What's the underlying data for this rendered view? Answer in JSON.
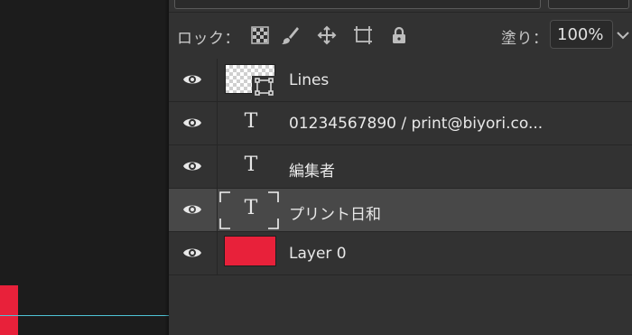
{
  "colors": {
    "accent_red": "#e8213a",
    "guide_cyan": "#4fc3d6"
  },
  "toolbar": {
    "lock_label": "ロック：",
    "lock_icons": [
      "lock-transparent-pixels-icon",
      "lock-image-pixels-icon",
      "lock-position-icon",
      "lock-artboard-icon",
      "lock-all-icon"
    ],
    "fill_label": "塗り：",
    "fill_value": "100%"
  },
  "layers": [
    {
      "name": "Lines",
      "kind": "shape",
      "visible": true,
      "selected": false
    },
    {
      "name": "01234567890  /   print@biyori.co...",
      "kind": "text",
      "visible": true,
      "selected": false
    },
    {
      "name": "編集者",
      "kind": "text",
      "visible": true,
      "selected": false
    },
    {
      "name": "プリント日和",
      "kind": "text",
      "visible": true,
      "selected": true
    },
    {
      "name": "Layer 0",
      "kind": "pixel",
      "visible": true,
      "selected": false
    }
  ],
  "type_icon_glyph": "T"
}
